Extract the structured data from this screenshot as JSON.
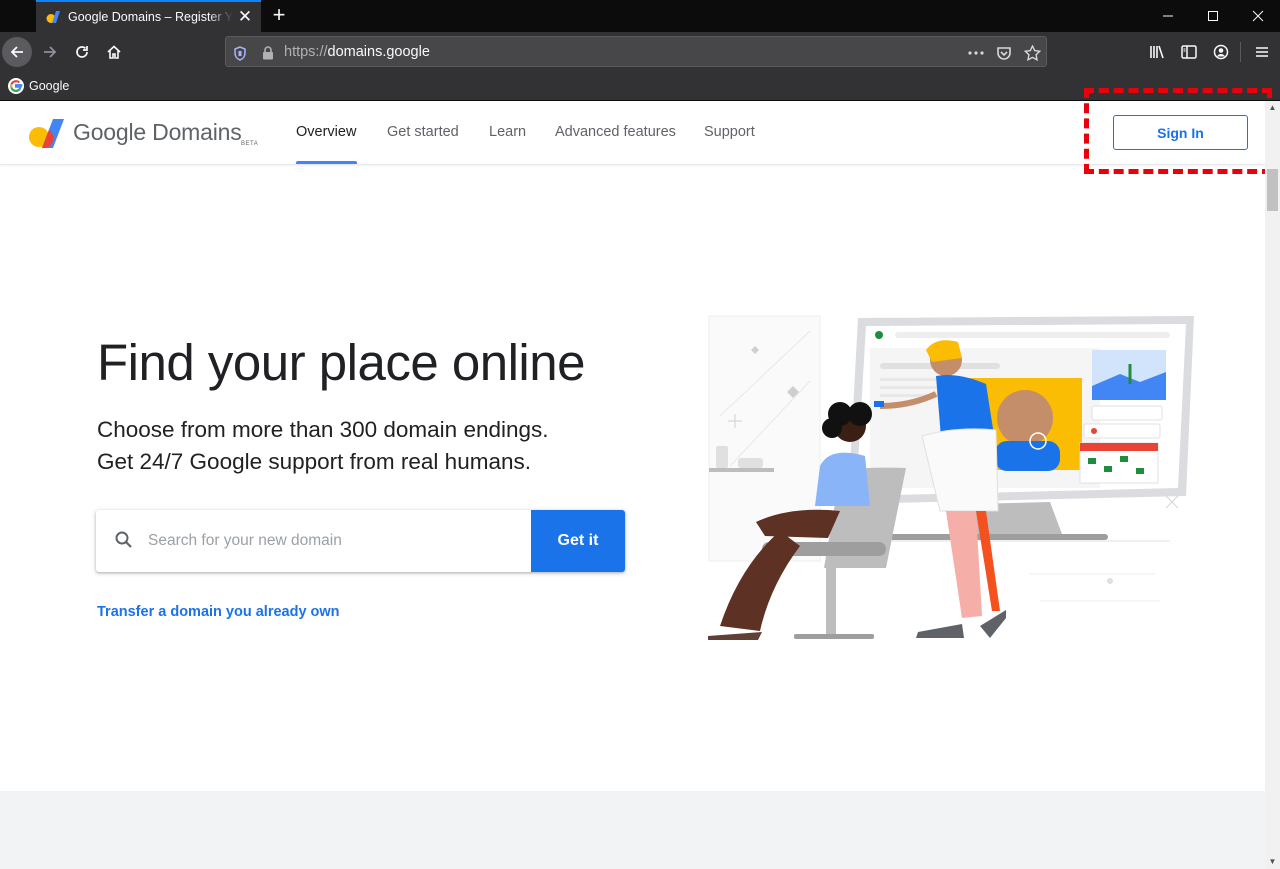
{
  "browser": {
    "tab_title": "Google Domains – Register Your Domain Name",
    "tab_close": "✕",
    "new_tab": "+",
    "url_scheme": "https://",
    "url_host": "domains.google",
    "bookmark_label": "Google"
  },
  "header": {
    "logo_text": "Google Domains",
    "logo_badge": "BETA",
    "nav": [
      {
        "label": "Overview",
        "active": true
      },
      {
        "label": "Get started"
      },
      {
        "label": "Learn"
      },
      {
        "label": "Advanced features"
      },
      {
        "label": "Support"
      }
    ],
    "sign_in": "Sign In"
  },
  "hero": {
    "title": "Find your place online",
    "subtitle_line1": "Choose from more than 300 domain endings.",
    "subtitle_line2": "Get 24/7 Google support from real humans.",
    "search_placeholder": "Search for your new domain",
    "search_button": "Get it",
    "transfer_link": "Transfer a domain you already own"
  },
  "colors": {
    "accent_blue": "#1a73e8",
    "highlight_red": "#e8000b",
    "chrome_dark": "#323234"
  },
  "icons": [
    "back-icon",
    "forward-icon",
    "reload-icon",
    "home-icon",
    "shield-icon",
    "lock-icon",
    "more-icon",
    "pocket-icon",
    "star-icon",
    "library-icon",
    "sidebar-icon",
    "account-icon",
    "menu-icon",
    "search-icon"
  ]
}
